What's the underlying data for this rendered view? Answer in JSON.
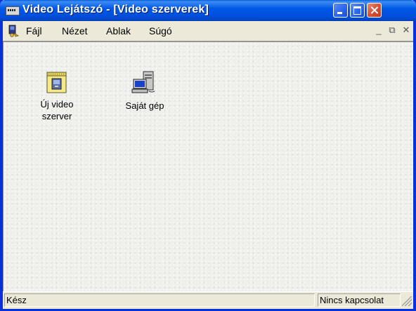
{
  "window": {
    "title": "Video Lejátszó - [Video szerverek]"
  },
  "menu": {
    "items": [
      {
        "label": "Fájl"
      },
      {
        "label": "Nézet"
      },
      {
        "label": "Ablak"
      },
      {
        "label": "Súgó"
      }
    ],
    "mdi_minimize": "_",
    "mdi_restore": "⧉",
    "mdi_close": "✕"
  },
  "desktop": {
    "items": [
      {
        "label": "Új video szerver",
        "icon": "new-server-icon"
      },
      {
        "label": "Saját gép",
        "icon": "computer-icon"
      }
    ]
  },
  "status": {
    "left": "Kész",
    "right": "Nincs kapcsolat"
  },
  "colors": {
    "titlebar": "#0054e3",
    "close_button": "#d6523a",
    "window_face": "#ece9d8"
  }
}
